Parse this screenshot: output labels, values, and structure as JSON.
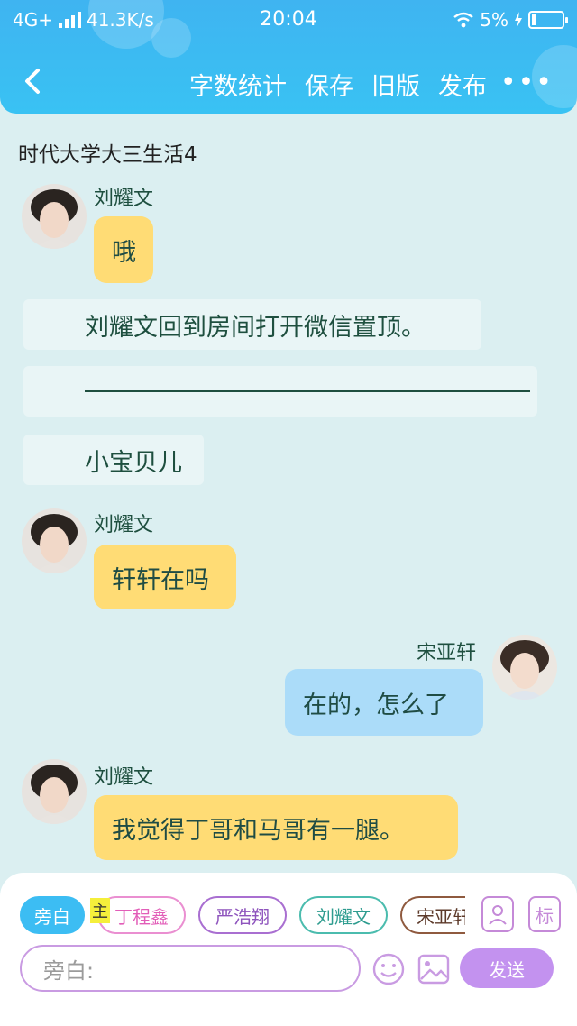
{
  "status": {
    "network": "4G+",
    "speed": "41.3K/s",
    "time": "20:04",
    "battery": "5%"
  },
  "nav": {
    "back_icon": "chevron-left-icon",
    "actions": [
      "字数统计",
      "保存",
      "旧版",
      "发布"
    ],
    "more": "•••"
  },
  "doc": {
    "title": "时代大学大三生活4"
  },
  "messages": {
    "m1": {
      "speaker": "刘耀文",
      "text": "哦"
    },
    "n1": {
      "text": "刘耀文回到房间打开微信置顶。"
    },
    "n2": {
      "text": "——————————————"
    },
    "n3": {
      "text": "小宝贝儿"
    },
    "m2": {
      "speaker": "刘耀文",
      "text": "轩轩在吗"
    },
    "m3": {
      "speaker": "宋亚轩",
      "text": "在的，怎么了"
    },
    "m4": {
      "speaker": "刘耀文",
      "text": "我觉得丁哥和马哥有一腿。"
    }
  },
  "panel": {
    "chips": [
      "旁白",
      "丁程鑫",
      "严浩翔",
      "刘耀文",
      "宋亚轩"
    ],
    "main_tag": "主",
    "icon_mark": "标",
    "input_placeholder": "旁白:",
    "send_label": "发送"
  },
  "colors": {
    "header": "#3fb4f1",
    "background": "#dbeff1",
    "yellow_bubble": "#ffdc75",
    "blue_bubble": "#abdcf9",
    "send": "#c392ef"
  }
}
